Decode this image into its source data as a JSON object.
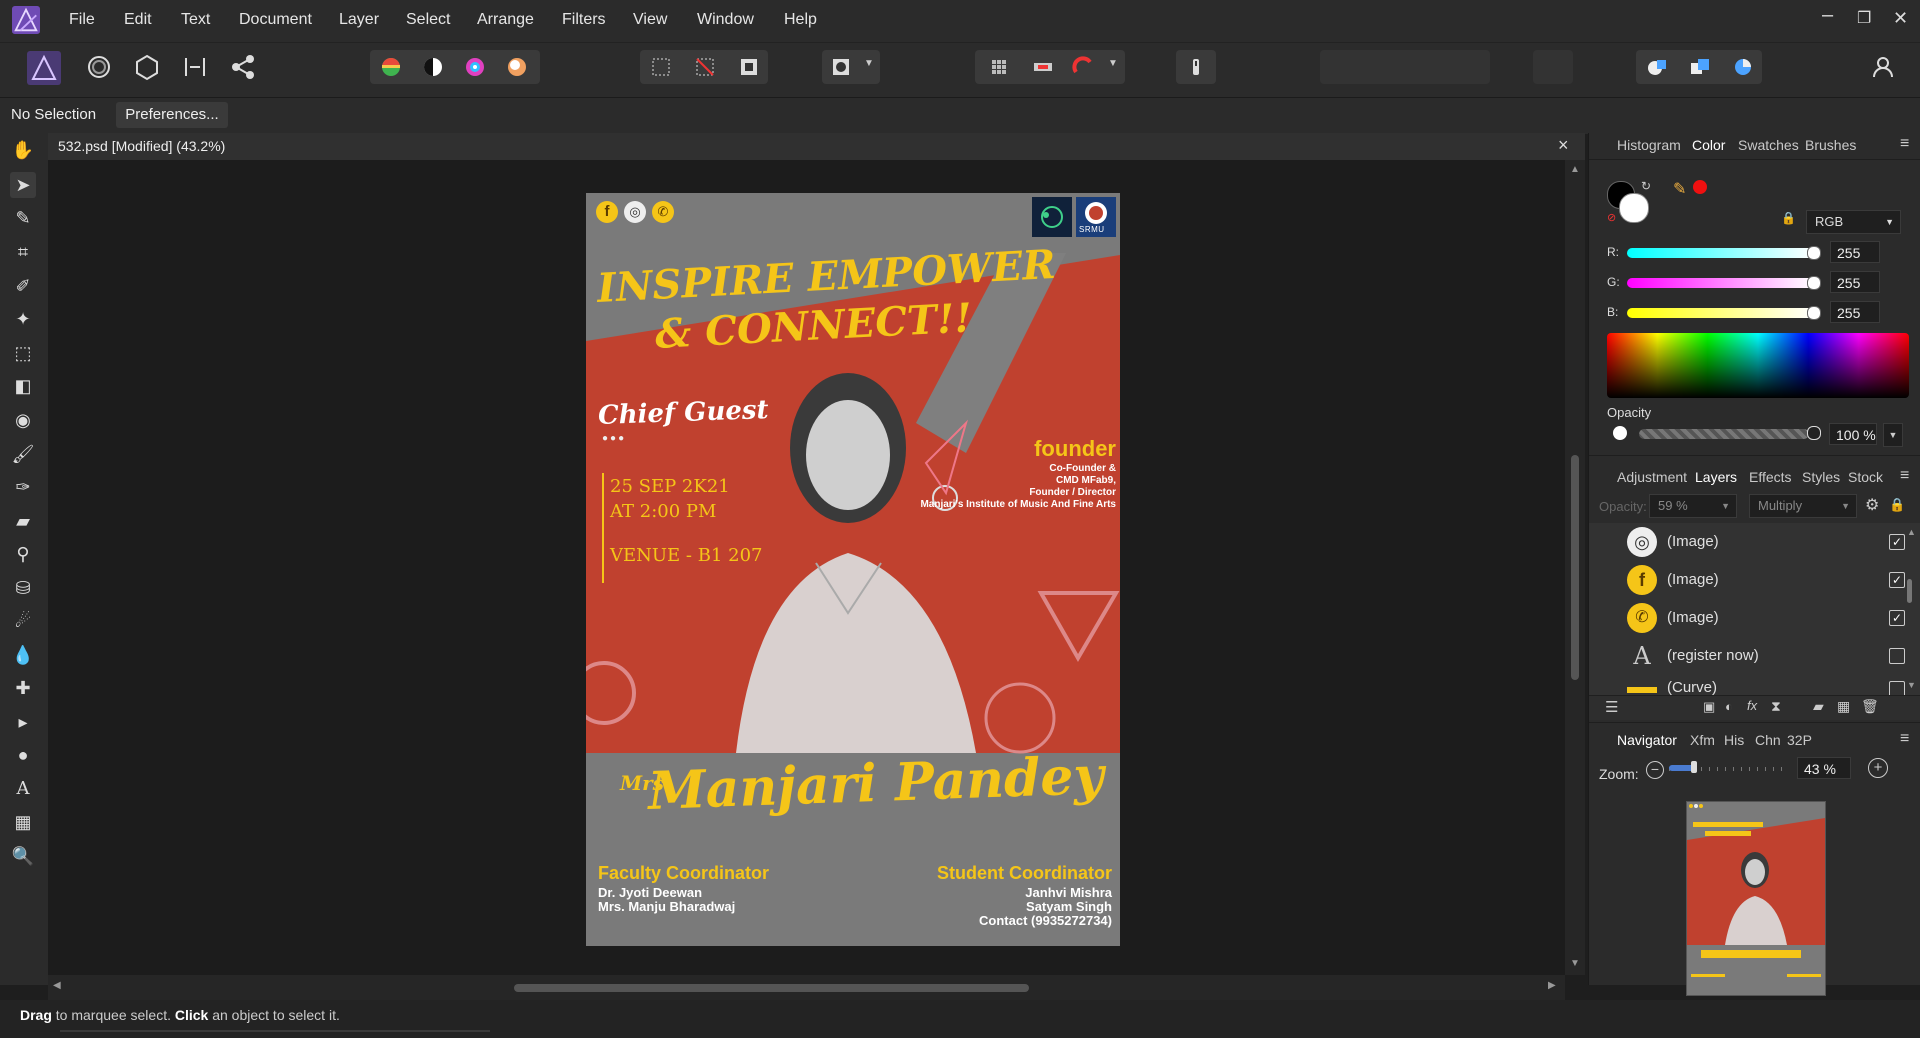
{
  "menu": [
    "File",
    "Edit",
    "Text",
    "Document",
    "Layer",
    "Select",
    "Arrange",
    "Filters",
    "View",
    "Window",
    "Help"
  ],
  "context": {
    "selection": "No Selection",
    "preferences": "Preferences..."
  },
  "document": {
    "tab_title": "532.psd [Modified] (43.2%)",
    "close": "×"
  },
  "poster": {
    "headline1": "INSPIRE EMPOWER",
    "headline2": "& CONNECT!!",
    "chief_guest": "Chief Guest",
    "date": "25 SEP 2K21",
    "time": "AT 2:00 PM",
    "venue": "VENUE - B1 207",
    "founder": "founder",
    "founder_lines": [
      "Co-Founder &",
      "CMD MFab9,",
      "Founder / Director",
      "Manjari's Institute of Music And Fine Arts"
    ],
    "name_prefix": "Mrs.",
    "name": "Manjari Pandey",
    "faculty_title": "Faculty Coordinator",
    "faculty": [
      "Dr. Jyoti Deewan",
      "Mrs. Manju Bharadwaj"
    ],
    "student_title": "Student Coordinator",
    "student": [
      "Janhvi Mishra",
      "Satyam Singh",
      "Contact (9935272734)"
    ],
    "logo_text": "SRMU"
  },
  "color_panel": {
    "tabs": [
      "Histogram",
      "Color",
      "Swatches",
      "Brushes"
    ],
    "active": "Color",
    "model": "RGB",
    "r_label": "R:",
    "g_label": "G:",
    "b_label": "B:",
    "r": "255",
    "g": "255",
    "b": "255",
    "opacity_label": "Opacity",
    "opacity": "100 %"
  },
  "layers_panel": {
    "tabs": [
      "Adjustment",
      "Layers",
      "Effects",
      "Styles",
      "Stock"
    ],
    "active": "Layers",
    "opacity_label": "Opacity:",
    "opacity": "59 %",
    "blend": "Multiply",
    "layers": [
      {
        "name": "(Image)",
        "checked": "✓"
      },
      {
        "name": "(Image)",
        "checked": "✓"
      },
      {
        "name": "(Image)",
        "checked": "✓"
      },
      {
        "name": "(register now)",
        "checked": ""
      },
      {
        "name": "(Curve)",
        "checked": ""
      }
    ]
  },
  "navigator_panel": {
    "tabs": [
      "Navigator",
      "Xfm",
      "His",
      "Chn",
      "32P"
    ],
    "active": "Navigator",
    "zoom_label": "Zoom:",
    "zoom": "43 %"
  },
  "status": {
    "drag": "Drag",
    "drag_text": " to marquee select. ",
    "click": "Click",
    "click_text": " an object to select it."
  },
  "colors": {
    "accent": "#f5c518",
    "poster_red": "#c0412f",
    "poster_grey": "#7a7a7a"
  }
}
